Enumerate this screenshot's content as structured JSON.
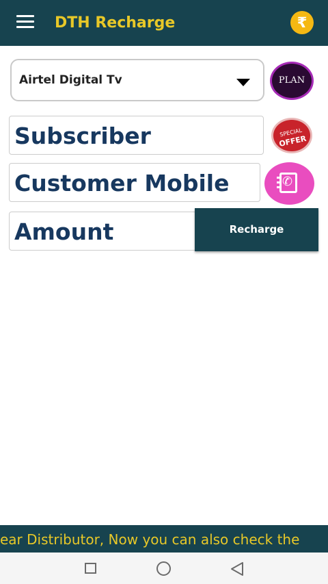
{
  "app_bar": {
    "title": "DTH Recharge",
    "menu_icon": "hamburger-menu-icon",
    "wallet_icon": "rupee-coin-icon",
    "wallet_symbol": "₹",
    "bg_color": "#17434f",
    "title_color": "#e8c828"
  },
  "form": {
    "operator": {
      "selected": "Airtel Digital Tv",
      "dropdown_icon": "caret-down-icon"
    },
    "plan_button_label": "PLAN",
    "subscriber_placeholder": "Subscriber",
    "special_offer": {
      "line1": "SPECIAL",
      "line2": "OFFER"
    },
    "customer_mobile_placeholder": "Customer Mobile",
    "contacts_icon": "contact-book-icon",
    "amount_placeholder": "Amount",
    "recharge_label": "Recharge"
  },
  "marquee": {
    "text": "ear Distributor, Now you can also check the "
  },
  "system_nav": {
    "recent_icon": "square-icon",
    "home_icon": "circle-icon",
    "back_icon": "triangle-back-icon"
  }
}
